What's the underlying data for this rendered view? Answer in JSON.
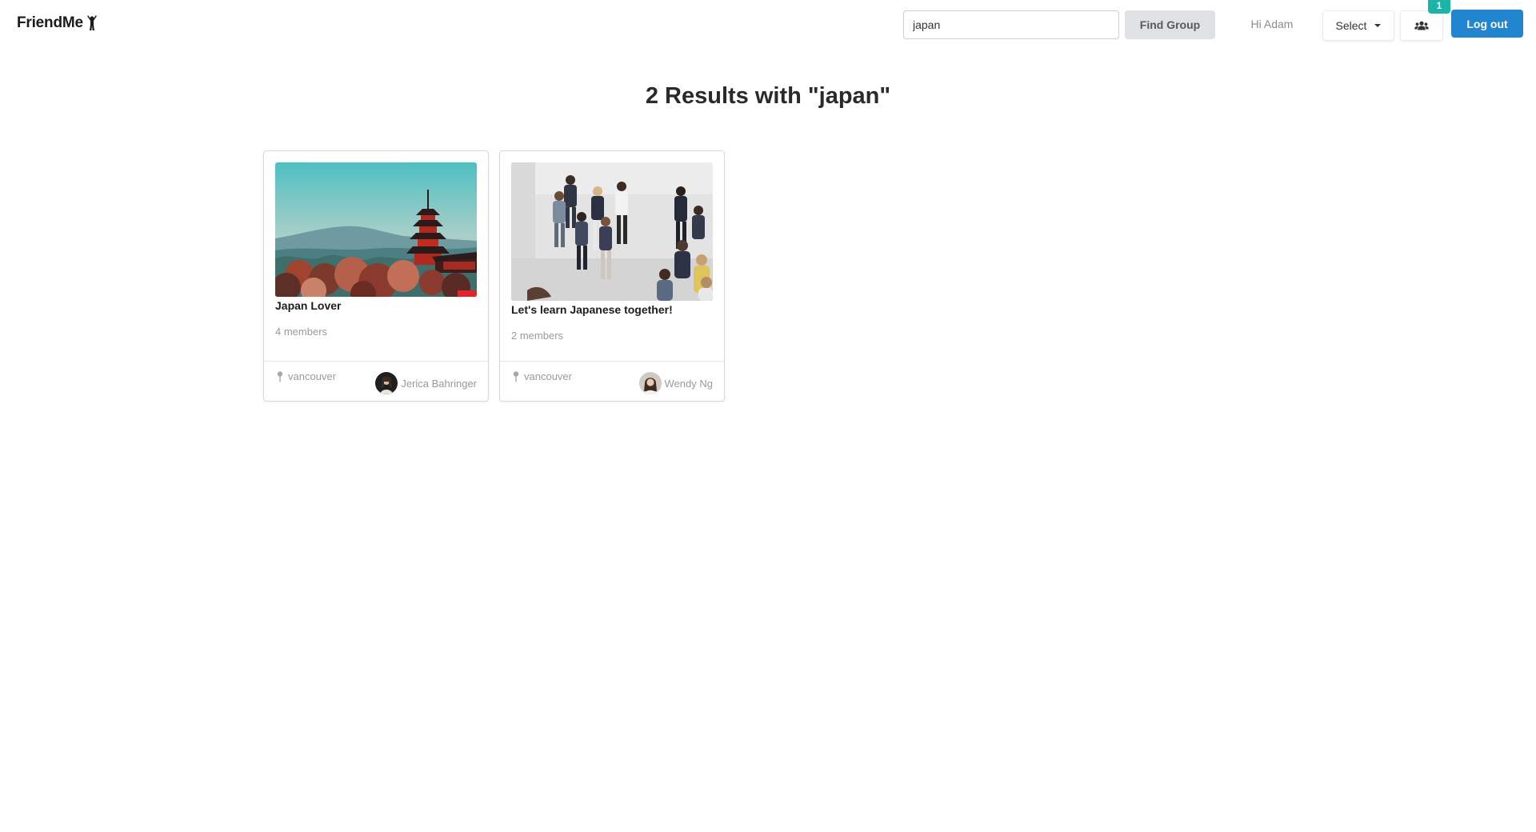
{
  "header": {
    "brand": "FriendMe",
    "search_value": "japan",
    "find_label": "Find Group",
    "greeting": "Hi Adam",
    "select_label": "Select",
    "notification_count": "1",
    "logout_label": "Log out"
  },
  "results": {
    "title": "2 Results with \"japan\""
  },
  "groups": [
    {
      "title": "Japan Lover",
      "members": "4 members",
      "location": "vancouver",
      "owner": "Jerica Bahringer"
    },
    {
      "title": "Let's learn Japanese together!",
      "members": "2 members",
      "location": "vancouver",
      "owner": "Wendy Ng"
    }
  ],
  "colors": {
    "primary_blue": "#2185d0",
    "badge_teal": "#1bb5a7",
    "find_button_bg": "#e0e1e2",
    "muted_text": "#9a9a9a"
  },
  "icons": [
    "person-arms-up-icon",
    "caret-down-icon",
    "users-icon",
    "map-pin-icon"
  ]
}
